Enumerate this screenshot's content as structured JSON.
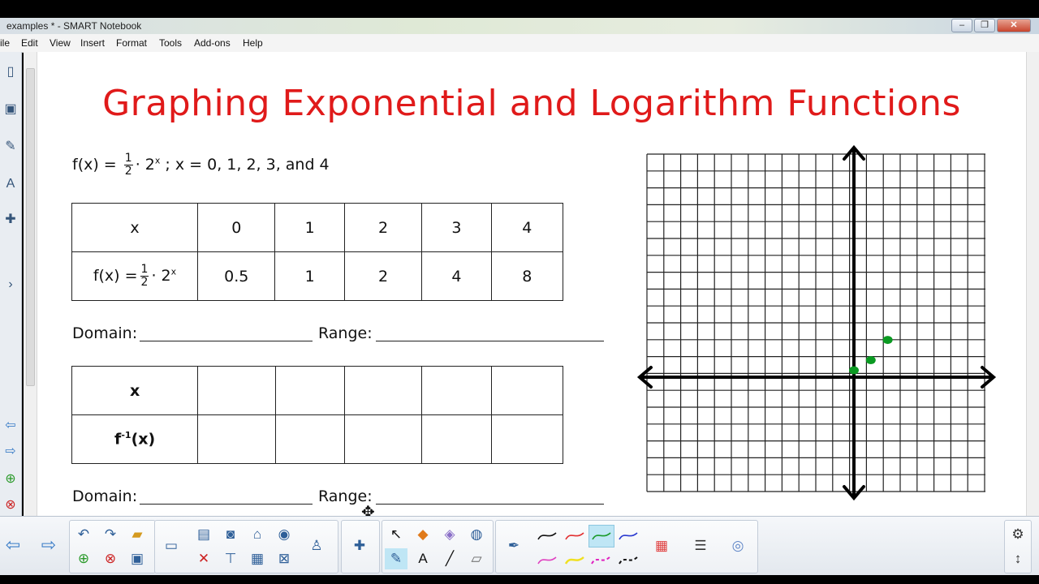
{
  "window": {
    "title": "examples * - SMART Notebook",
    "controls": [
      "–",
      "❐",
      "✕"
    ]
  },
  "menu": [
    "ile",
    "Edit",
    "View",
    "Insert",
    "Format",
    "Tools",
    "Add-ons",
    "Help"
  ],
  "page": {
    "heading": "Graphing Exponential and Logarithm Functions",
    "function_prefix": "f(x) =",
    "frac_num": "1",
    "frac_den": "2",
    "function_mid": "· 2",
    "exponent": "x",
    "function_suffix": "; x = 0, 1, 2, 3, and 4",
    "table1": {
      "row1_label": "x",
      "x_values": [
        "0",
        "1",
        "2",
        "3",
        "4"
      ],
      "row2_label_prefix": "f(x) =",
      "row2_label_mid": "· 2",
      "fx_values": [
        "0.5",
        "1",
        "2",
        "4",
        "8"
      ]
    },
    "domain_label": "Domain:",
    "range_label": "Range:",
    "table2": {
      "row1_label": "x",
      "row2_label_f": "f",
      "row2_label_exp": "-1",
      "row2_label_x": "(x)"
    }
  },
  "graph_points": [
    {
      "x": 0,
      "y": 0.5
    },
    {
      "x": 1,
      "y": 1
    },
    {
      "x": 2,
      "y": 2
    }
  ],
  "colors": {
    "heading": "#e01a1a",
    "handwriting": "#0b9a22"
  },
  "toolbar": {
    "icons": [
      "back-arrow-icon",
      "forward-arrow-icon",
      "undo-icon",
      "redo-icon",
      "add-page-icon",
      "delete-page-icon",
      "open-icon",
      "save-icon",
      "screen-icon",
      "paste-icon",
      "cancel-icon",
      "screen-capture-icon",
      "screen-shade-icon",
      "table-icon",
      "document-camera-icon",
      "addon-icon",
      "select-icon",
      "pens-icon",
      "shapes-icon",
      "text-icon",
      "line-icon",
      "eraser-icon",
      "fill-icon",
      "properties-icon",
      "settings-icon"
    ]
  }
}
